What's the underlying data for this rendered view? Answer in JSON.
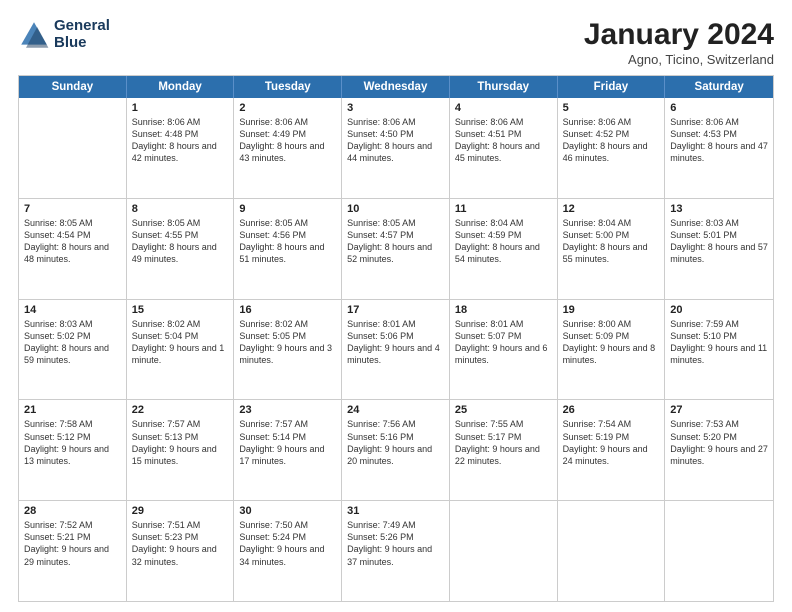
{
  "logo": {
    "line1": "General",
    "line2": "Blue"
  },
  "title": "January 2024",
  "location": "Agno, Ticino, Switzerland",
  "header_days": [
    "Sunday",
    "Monday",
    "Tuesday",
    "Wednesday",
    "Thursday",
    "Friday",
    "Saturday"
  ],
  "rows": [
    [
      {
        "day": "",
        "sunrise": "",
        "sunset": "",
        "daylight": ""
      },
      {
        "day": "1",
        "sunrise": "Sunrise: 8:06 AM",
        "sunset": "Sunset: 4:48 PM",
        "daylight": "Daylight: 8 hours and 42 minutes."
      },
      {
        "day": "2",
        "sunrise": "Sunrise: 8:06 AM",
        "sunset": "Sunset: 4:49 PM",
        "daylight": "Daylight: 8 hours and 43 minutes."
      },
      {
        "day": "3",
        "sunrise": "Sunrise: 8:06 AM",
        "sunset": "Sunset: 4:50 PM",
        "daylight": "Daylight: 8 hours and 44 minutes."
      },
      {
        "day": "4",
        "sunrise": "Sunrise: 8:06 AM",
        "sunset": "Sunset: 4:51 PM",
        "daylight": "Daylight: 8 hours and 45 minutes."
      },
      {
        "day": "5",
        "sunrise": "Sunrise: 8:06 AM",
        "sunset": "Sunset: 4:52 PM",
        "daylight": "Daylight: 8 hours and 46 minutes."
      },
      {
        "day": "6",
        "sunrise": "Sunrise: 8:06 AM",
        "sunset": "Sunset: 4:53 PM",
        "daylight": "Daylight: 8 hours and 47 minutes."
      }
    ],
    [
      {
        "day": "7",
        "sunrise": "Sunrise: 8:05 AM",
        "sunset": "Sunset: 4:54 PM",
        "daylight": "Daylight: 8 hours and 48 minutes."
      },
      {
        "day": "8",
        "sunrise": "Sunrise: 8:05 AM",
        "sunset": "Sunset: 4:55 PM",
        "daylight": "Daylight: 8 hours and 49 minutes."
      },
      {
        "day": "9",
        "sunrise": "Sunrise: 8:05 AM",
        "sunset": "Sunset: 4:56 PM",
        "daylight": "Daylight: 8 hours and 51 minutes."
      },
      {
        "day": "10",
        "sunrise": "Sunrise: 8:05 AM",
        "sunset": "Sunset: 4:57 PM",
        "daylight": "Daylight: 8 hours and 52 minutes."
      },
      {
        "day": "11",
        "sunrise": "Sunrise: 8:04 AM",
        "sunset": "Sunset: 4:59 PM",
        "daylight": "Daylight: 8 hours and 54 minutes."
      },
      {
        "day": "12",
        "sunrise": "Sunrise: 8:04 AM",
        "sunset": "Sunset: 5:00 PM",
        "daylight": "Daylight: 8 hours and 55 minutes."
      },
      {
        "day": "13",
        "sunrise": "Sunrise: 8:03 AM",
        "sunset": "Sunset: 5:01 PM",
        "daylight": "Daylight: 8 hours and 57 minutes."
      }
    ],
    [
      {
        "day": "14",
        "sunrise": "Sunrise: 8:03 AM",
        "sunset": "Sunset: 5:02 PM",
        "daylight": "Daylight: 8 hours and 59 minutes."
      },
      {
        "day": "15",
        "sunrise": "Sunrise: 8:02 AM",
        "sunset": "Sunset: 5:04 PM",
        "daylight": "Daylight: 9 hours and 1 minute."
      },
      {
        "day": "16",
        "sunrise": "Sunrise: 8:02 AM",
        "sunset": "Sunset: 5:05 PM",
        "daylight": "Daylight: 9 hours and 3 minutes."
      },
      {
        "day": "17",
        "sunrise": "Sunrise: 8:01 AM",
        "sunset": "Sunset: 5:06 PM",
        "daylight": "Daylight: 9 hours and 4 minutes."
      },
      {
        "day": "18",
        "sunrise": "Sunrise: 8:01 AM",
        "sunset": "Sunset: 5:07 PM",
        "daylight": "Daylight: 9 hours and 6 minutes."
      },
      {
        "day": "19",
        "sunrise": "Sunrise: 8:00 AM",
        "sunset": "Sunset: 5:09 PM",
        "daylight": "Daylight: 9 hours and 8 minutes."
      },
      {
        "day": "20",
        "sunrise": "Sunrise: 7:59 AM",
        "sunset": "Sunset: 5:10 PM",
        "daylight": "Daylight: 9 hours and 11 minutes."
      }
    ],
    [
      {
        "day": "21",
        "sunrise": "Sunrise: 7:58 AM",
        "sunset": "Sunset: 5:12 PM",
        "daylight": "Daylight: 9 hours and 13 minutes."
      },
      {
        "day": "22",
        "sunrise": "Sunrise: 7:57 AM",
        "sunset": "Sunset: 5:13 PM",
        "daylight": "Daylight: 9 hours and 15 minutes."
      },
      {
        "day": "23",
        "sunrise": "Sunrise: 7:57 AM",
        "sunset": "Sunset: 5:14 PM",
        "daylight": "Daylight: 9 hours and 17 minutes."
      },
      {
        "day": "24",
        "sunrise": "Sunrise: 7:56 AM",
        "sunset": "Sunset: 5:16 PM",
        "daylight": "Daylight: 9 hours and 20 minutes."
      },
      {
        "day": "25",
        "sunrise": "Sunrise: 7:55 AM",
        "sunset": "Sunset: 5:17 PM",
        "daylight": "Daylight: 9 hours and 22 minutes."
      },
      {
        "day": "26",
        "sunrise": "Sunrise: 7:54 AM",
        "sunset": "Sunset: 5:19 PM",
        "daylight": "Daylight: 9 hours and 24 minutes."
      },
      {
        "day": "27",
        "sunrise": "Sunrise: 7:53 AM",
        "sunset": "Sunset: 5:20 PM",
        "daylight": "Daylight: 9 hours and 27 minutes."
      }
    ],
    [
      {
        "day": "28",
        "sunrise": "Sunrise: 7:52 AM",
        "sunset": "Sunset: 5:21 PM",
        "daylight": "Daylight: 9 hours and 29 minutes."
      },
      {
        "day": "29",
        "sunrise": "Sunrise: 7:51 AM",
        "sunset": "Sunset: 5:23 PM",
        "daylight": "Daylight: 9 hours and 32 minutes."
      },
      {
        "day": "30",
        "sunrise": "Sunrise: 7:50 AM",
        "sunset": "Sunset: 5:24 PM",
        "daylight": "Daylight: 9 hours and 34 minutes."
      },
      {
        "day": "31",
        "sunrise": "Sunrise: 7:49 AM",
        "sunset": "Sunset: 5:26 PM",
        "daylight": "Daylight: 9 hours and 37 minutes."
      },
      {
        "day": "",
        "sunrise": "",
        "sunset": "",
        "daylight": ""
      },
      {
        "day": "",
        "sunrise": "",
        "sunset": "",
        "daylight": ""
      },
      {
        "day": "",
        "sunrise": "",
        "sunset": "",
        "daylight": ""
      }
    ]
  ]
}
